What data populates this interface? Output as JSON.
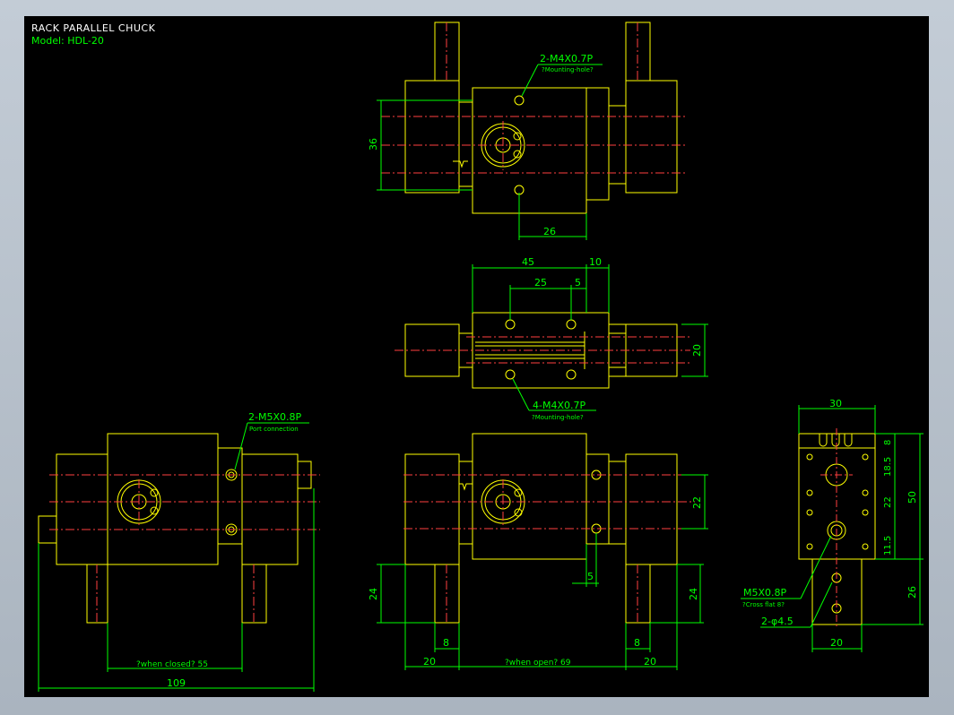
{
  "title": "RACK PARALLEL CHUCK",
  "model": "Model: HDL-20",
  "colors": {
    "background": "#000000",
    "outline": "#ffff00",
    "centerline": "#ff0000",
    "dimension": "#00ff00",
    "frame": "#b9c2cc"
  },
  "dims": {
    "d36": "36",
    "d26_top": "26",
    "d45": "45",
    "d10": "10",
    "d25": "25",
    "d5_mid": "5",
    "d20_mid": "20",
    "d22": "22",
    "d5_bot": "5",
    "d24_left": "24",
    "d24_right": "24",
    "d8_left": "8",
    "d8_right": "8",
    "d20_left": "20",
    "d20_right": "20",
    "d69": "?when open? 69",
    "d55": "?when closed? 55",
    "d109": "109",
    "d30": "30",
    "r8": "8",
    "r18_5": "18.5",
    "r22": "22",
    "r11_5": "11.5",
    "r50": "50",
    "r26": "26",
    "r20_bot": "20"
  },
  "notes": {
    "top_hole": "2-M4X0.7P",
    "top_hole_sub": "?Mounting-hole?",
    "mid_hole": "4-M4X0.7P",
    "mid_hole_sub": "?Mounting-hole?",
    "port": "2-M5X0.8P",
    "port_sub": "Port connection",
    "cross": "M5X0.8P",
    "cross_sub": "?Cross flat 8?",
    "phi": "2-φ4.5"
  }
}
